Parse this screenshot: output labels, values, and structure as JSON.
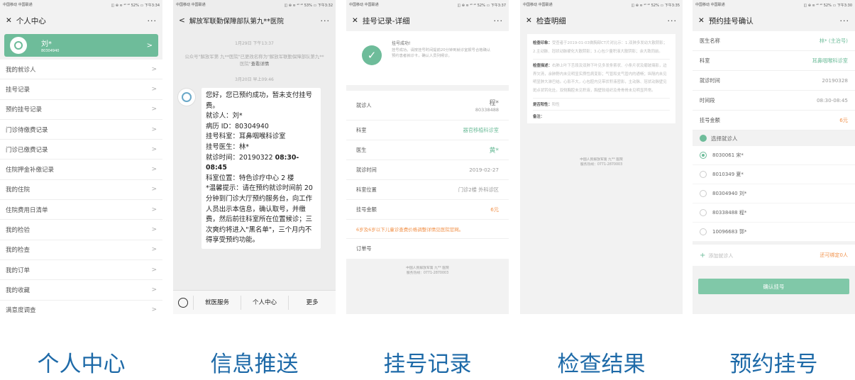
{
  "phones": [
    {
      "status": {
        "carrier": "中国移动\n中国联通",
        "right": "◫ ⊕ ≋ ᵃˡˡ ᵃˡˡ 52% ▭ 下午3:34"
      },
      "title": "个人中心",
      "close": "✕",
      "more": "···",
      "user": {
        "name": "刘*",
        "id": "80304940"
      },
      "menu": [
        "我的就诊人",
        "挂号记录",
        "预约挂号记录",
        "门诊待缴费记录",
        "门诊已缴费记录",
        "住院押金补缴记录",
        "我的住院",
        "住院费用日清单",
        "我的检验",
        "我的检查",
        "我的订单",
        "我的收藏",
        "满意度调查"
      ],
      "chevron": ">"
    },
    {
      "status": {
        "carrier": "中国移动\n中国联通",
        "right": "◫ ⊕ ≋ ᵃˡˡ ᵃˡˡ 53% ▭ 下午3:32"
      },
      "back": "<",
      "title": "解放军联勤保障部队第九**医院",
      "more": "···",
      "time1": "1月29日 下午13:37",
      "notice": "公众号\"解放军第 九**医院\"已更改名称为\"解放军联勤保障部队第九**医院\"",
      "notice_link": "查看详情",
      "time2": "3月20日 早上09:46",
      "message": {
        "l1": "您好，您已预约成功，暂未支付挂号费。",
        "l2": "就诊人：刘*",
        "l3": "病历 ID：80304940",
        "l4": "挂号科室：耳鼻咽喉科诊室",
        "l5": "挂号医生：林*",
        "l6a": "就诊时间：20190322 ",
        "l6b": "08:30-08:45",
        "l7": "科室位置：特色诊疗中心 2 楼",
        "l8": "*温馨提示：请在预约就诊时间前 20 分钟到门诊大厅预约服务台，向工作人员出示本信息，确认取号，并缴费，然后前往科室所在位置候诊；三次爽约将进入\"黑名单\"，三个月内不得享受预约功能。"
      },
      "tabs": [
        "就医服务",
        "个人中心",
        "更多"
      ]
    },
    {
      "status": {
        "carrier": "中国移动\n中国联通",
        "right": "◫ ⊕ ≋ ᵃˡˡ ᵃˡˡ 52% ▭ 下午3:37"
      },
      "title": "挂号记录-详细",
      "close": "✕",
      "more": "···",
      "success_title": "挂号成功!",
      "success_desc": "挂号成功。请按挂号时间提前20分钟到就诊室报号合格确认预约患者就诊卡，确认人员列候诊。",
      "rows": {
        "patient_label": "就诊人",
        "patient_name": "程*",
        "patient_id": "80338488",
        "dept_label": "科室",
        "dept": "器官移植科诊室",
        "doctor_label": "医生",
        "doctor": "黄*",
        "time_label": "就诊时间",
        "time": "2019-02-27",
        "loc_label": "科室位置",
        "loc": "门诊2楼 外科诊区",
        "fee_label": "挂号金额",
        "fee": "6元",
        "warn": "6岁及6岁以下儿童诊查费价格调整详情见医院官网。",
        "order_label": "订单号"
      },
      "footer": {
        "l1": "中国人民解放军第 九** 医院",
        "l2": "服务热线：0771-2870003"
      }
    },
    {
      "status": {
        "carrier": "中国移动\n中国联通",
        "right": "◫ ⊕ ≋ ᵃˡˡ ᵃˡˡ 52% ▭ 下午3:35"
      },
      "title": "检查明细",
      "close": "✕",
      "more": "···",
      "impression_label": "检查印象：",
      "impression": "受查者于2019-01-03做胸部CT片对比示：1.双肺多发幼大散阴影；2.主动脉、冠状动脉硬化大散阴影；3.心包少量积液大散阴影；余大致同前。",
      "desc_label": "检查描述：",
      "desc": "右肺上叶下舌段及双肺下叶见多发条索状、小条片状及磨玻璃影，边界欠清，余肺野内未见明显实质性病变影；气管和支气管内的通畅；纵隔内未见明显肿大淋巴结。心影不大，心包腔内见带状积液密影，主动脉、冠状动脉壁见斑点状钙化灶。双侧胸腔未见积液，胸壁软组织及骨骨骨未见明显异常。",
      "positive_label": "是否阳性：",
      "positive": "阳性",
      "note_label": "备注：",
      "footer": {
        "l1": "中国人民解放军第 九** 医院",
        "l2": "服务热线：0771-2870003"
      }
    },
    {
      "status": {
        "carrier": "中国移动\n中国联通",
        "right": "◫ ⊕ ≋ ᵃˡˡ ᵃˡˡ 52% ▭ 下午3:30"
      },
      "title": "预约挂号确认",
      "close": "✕",
      "more": "···",
      "rows": [
        {
          "label": "医生名称",
          "value": "林*  (主治号)"
        },
        {
          "label": "科室",
          "value": "耳鼻咽喉科诊室"
        },
        {
          "label": "就诊时间",
          "value": "20190328"
        },
        {
          "label": "时间段",
          "value": "08:30-08:45"
        },
        {
          "label": "挂号金额",
          "value": "6元"
        }
      ],
      "select_label": "选择就诊人",
      "patients": [
        "8030061 宋*",
        "8010349 夏*",
        "80304940 刘*",
        "80338488 程*",
        "10096683 郭*"
      ],
      "add_label": "添加就诊人",
      "add_hint": "还可绑定0人",
      "confirm": "确认挂号"
    }
  ],
  "captions": [
    "个人中心",
    "信息推送",
    "挂号记录",
    "检查结果",
    "预约挂号"
  ],
  "colors": {
    "accent": "#6ebc9a",
    "caption": "#1e6aa8",
    "warn": "#f19149"
  }
}
